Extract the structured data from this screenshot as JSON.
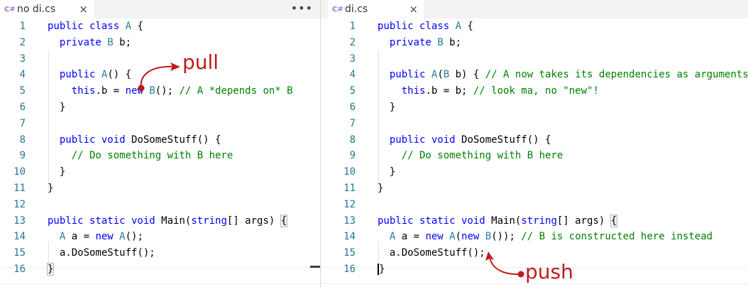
{
  "colors": {
    "keyword": "#0000ff",
    "type": "#267f99",
    "comment": "#008000",
    "line_number": "#237893",
    "annotation": "#c01b1b"
  },
  "left": {
    "tab": {
      "icon": "C#",
      "title": "no di.cs",
      "close": "×"
    },
    "more": "•••",
    "line_numbers": [
      "1",
      "2",
      "3",
      "4",
      "5",
      "6",
      "7",
      "8",
      "9",
      "10",
      "11",
      "12",
      "13",
      "14",
      "15",
      "16"
    ],
    "code": [
      [
        [
          "kw",
          "public class "
        ],
        [
          "ty",
          "A"
        ],
        [
          "",
          " {"
        ]
      ],
      [
        [
          "",
          "  "
        ],
        [
          "kw",
          "private "
        ],
        [
          "ty",
          "B"
        ],
        [
          "",
          " b;"
        ]
      ],
      [],
      [
        [
          "",
          "  "
        ],
        [
          "kw",
          "public "
        ],
        [
          "ty",
          "A"
        ],
        [
          "",
          "() {"
        ]
      ],
      [
        [
          "",
          "    "
        ],
        [
          "kw",
          "this"
        ],
        [
          "",
          ".b = "
        ],
        [
          "kw",
          "new "
        ],
        [
          "ty",
          "B"
        ],
        [
          "",
          "(); "
        ],
        [
          "cm",
          "// A *depends on* B"
        ]
      ],
      [
        [
          "",
          "  }"
        ]
      ],
      [],
      [
        [
          "",
          "  "
        ],
        [
          "kw",
          "public void "
        ],
        [
          "",
          "DoSomeStuff() {"
        ]
      ],
      [
        [
          "",
          "    "
        ],
        [
          "cm",
          "// Do something with B here"
        ]
      ],
      [
        [
          "",
          "  }"
        ]
      ],
      [
        [
          "",
          "}"
        ]
      ],
      [],
      [
        [
          "kw",
          "public static void "
        ],
        [
          "",
          "Main("
        ],
        [
          "kw",
          "string"
        ],
        [
          "",
          "[] args) "
        ],
        [
          "match",
          "{"
        ]
      ],
      [
        [
          "",
          "  "
        ],
        [
          "ty",
          "A"
        ],
        [
          "",
          " a = "
        ],
        [
          "kw",
          "new "
        ],
        [
          "ty",
          "A"
        ],
        [
          "",
          "();"
        ]
      ],
      [
        [
          "",
          "  a.DoSomeStuff();"
        ]
      ],
      [
        [
          "match",
          "}"
        ]
      ]
    ],
    "annotation": "pull"
  },
  "right": {
    "tab": {
      "icon": "C#",
      "title": "di.cs",
      "close": "×"
    },
    "line_numbers": [
      "1",
      "2",
      "3",
      "4",
      "5",
      "6",
      "7",
      "8",
      "9",
      "10",
      "11",
      "12",
      "13",
      "14",
      "15",
      "16"
    ],
    "code": [
      [
        [
          "kw",
          "public class "
        ],
        [
          "ty",
          "A"
        ],
        [
          "",
          " {"
        ]
      ],
      [
        [
          "",
          "  "
        ],
        [
          "kw",
          "private "
        ],
        [
          "ty",
          "B"
        ],
        [
          "",
          " b;"
        ]
      ],
      [],
      [
        [
          "",
          "  "
        ],
        [
          "kw",
          "public "
        ],
        [
          "ty",
          "A"
        ],
        [
          "",
          "("
        ],
        [
          "ty",
          "B"
        ],
        [
          "",
          " b) { "
        ],
        [
          "cm",
          "// A now takes its dependencies as arguments"
        ]
      ],
      [
        [
          "",
          "    "
        ],
        [
          "kw",
          "this"
        ],
        [
          "",
          ".b = b; "
        ],
        [
          "cm",
          "// look ma, no \"new\"!"
        ]
      ],
      [
        [
          "",
          "  }"
        ]
      ],
      [],
      [
        [
          "",
          "  "
        ],
        [
          "kw",
          "public void "
        ],
        [
          "",
          "DoSomeStuff() {"
        ]
      ],
      [
        [
          "",
          "    "
        ],
        [
          "cm",
          "// Do something with B here"
        ]
      ],
      [
        [
          "",
          "  }"
        ]
      ],
      [
        [
          "",
          "}"
        ]
      ],
      [],
      [
        [
          "kw",
          "public static void "
        ],
        [
          "",
          "Main("
        ],
        [
          "kw",
          "string"
        ],
        [
          "",
          "[] args) "
        ],
        [
          "match",
          "{"
        ]
      ],
      [
        [
          "",
          "  "
        ],
        [
          "ty",
          "A"
        ],
        [
          "",
          " a = "
        ],
        [
          "kw",
          "new "
        ],
        [
          "ty",
          "A"
        ],
        [
          "",
          "("
        ],
        [
          "kw",
          "new "
        ],
        [
          "ty",
          "B"
        ],
        [
          "",
          "()); "
        ],
        [
          "cm",
          "// B is constructed here instead"
        ]
      ],
      [
        [
          "",
          "  a.DoSomeStuff();"
        ]
      ],
      [
        [
          "cursor",
          "}"
        ]
      ]
    ],
    "annotation": "push"
  }
}
